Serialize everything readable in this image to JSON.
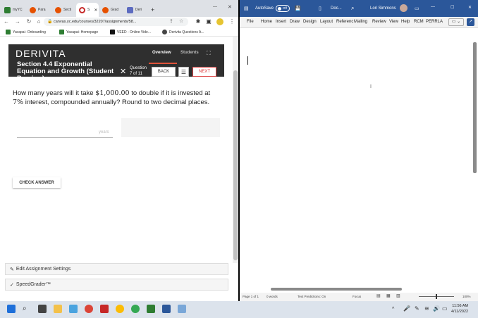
{
  "browser": {
    "tabs": [
      {
        "label": "myYC",
        "color": "#2e7d32"
      },
      {
        "label": "Para",
        "color": "#e65100"
      },
      {
        "label": "Secti",
        "color": "#e65100"
      },
      {
        "label": "S",
        "color": "#c62828"
      },
      {
        "label": "Grad",
        "color": "#e65100"
      },
      {
        "label": "Deri",
        "color": "#5c6bc0"
      }
    ],
    "active_tab_close": "✕",
    "new_tab": "+",
    "url": "canvas.yc.edu/courses/32207/assignments/58...",
    "bookmarks": [
      {
        "label": "Yavapai- Onboarding",
        "color": "#2e7d32"
      },
      {
        "label": "Yavapai- Homepage",
        "color": "#2e7d32"
      },
      {
        "label": "VEED - Online Vide...",
        "color": "#111111"
      },
      {
        "label": "Derivita Questions A...",
        "color": "#444444"
      }
    ]
  },
  "derivita": {
    "logo": "DERIVITA",
    "tab_overview": "Overview",
    "tab_students": "Students",
    "section_title": "Section 4.4 Exponential Equation and Growth (Student Preview)",
    "question_counter_line1": "Question",
    "question_counter_line2": "7 of 11",
    "back_label": "BACK",
    "next_label": "NEXT",
    "question_part1": "How many years will it take ",
    "question_amount": "$1,000.00",
    "question_part2": " to double if it is invested at ",
    "question_rate": "7%",
    "question_part3": " interest, compounded annually? Round to two decimal places.",
    "answer_unit": "years",
    "check_answer": "CHECK ANSWER",
    "accent_color": "#e0533a"
  },
  "canvas_links": {
    "edit_settings": "Edit Assignment Settings",
    "speedgrader": "SpeedGrader™"
  },
  "word": {
    "autosave_label": "AutoSave",
    "autosave_state": "Off",
    "doc_name": "Doc...",
    "user_name": "Lori Simmons",
    "ribbon_tabs": [
      "File",
      "Home",
      "Insert",
      "Draw",
      "Design",
      "Layout",
      "Referenc",
      "Mailing",
      "Review",
      "View",
      "Help",
      "RCM",
      "PERRLA"
    ],
    "status": {
      "page": "Page 1 of 1",
      "words": "0 words",
      "predictions": "Text Predictions: On",
      "focus": "Focus",
      "zoom": "100%"
    },
    "brand_color": "#2b579a"
  },
  "taskbar": {
    "time": "11:56 AM",
    "date": "4/11/2022"
  }
}
